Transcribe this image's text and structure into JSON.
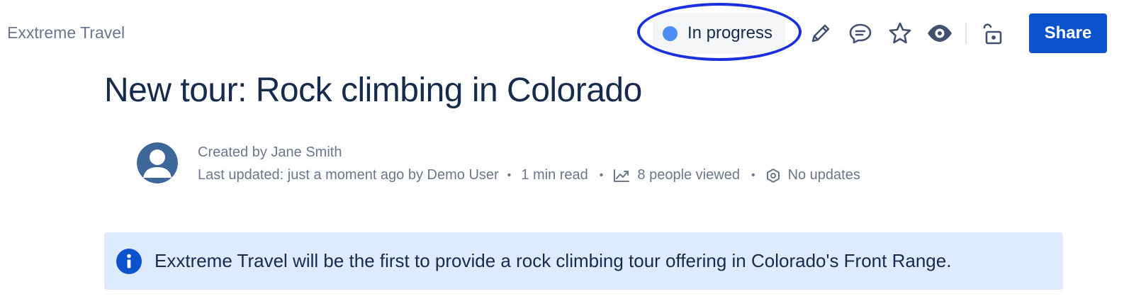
{
  "breadcrumb": {
    "space_name": "Exxtreme Travel"
  },
  "toolbar": {
    "status": {
      "label": "In progress",
      "dot_color": "#4c8cf5"
    },
    "icons": [
      "pencil-icon",
      "comment-icon",
      "star-icon",
      "eye-icon",
      "unlock-icon"
    ],
    "share_label": "Share",
    "share_color": "#0c52cc"
  },
  "page": {
    "title": "New tour: Rock climbing in Colorado"
  },
  "byline": {
    "created": "Created by Jane Smith",
    "last_updated": "Last updated: just a moment ago by Demo User",
    "separator": "•",
    "read_time": "1 min read",
    "views": "8 people viewed",
    "updates": "No updates"
  },
  "info_panel": {
    "icon": "info-icon",
    "text": "Exxtreme Travel will be the first to provide a rock climbing tour offering in Colorado's Front Range.",
    "background": "#deebff"
  }
}
